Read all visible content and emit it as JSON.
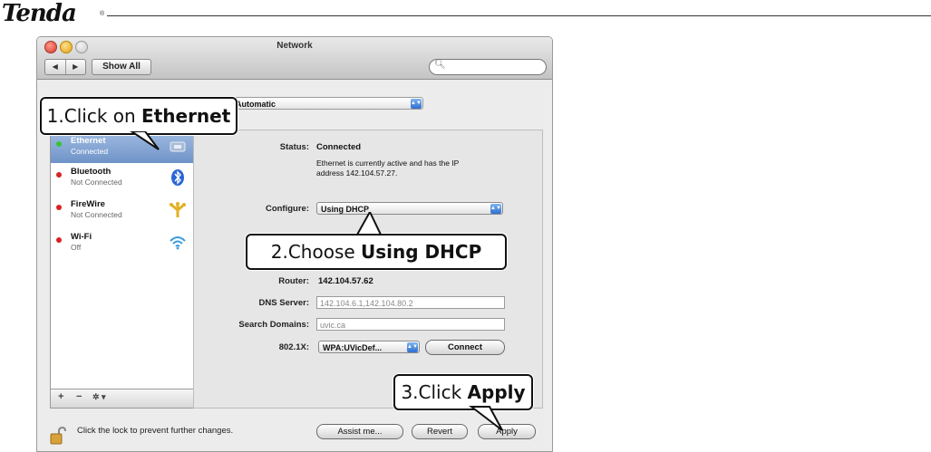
{
  "brand": {
    "name": "Tenda",
    "tm": "®"
  },
  "window": {
    "title": "Network",
    "nav_back": "◀",
    "nav_forward": "▶",
    "show_all": "Show All",
    "search_placeholder": ""
  },
  "location": {
    "value": "Automatic"
  },
  "services": [
    {
      "name": "Ethernet",
      "status": "Connected",
      "dot": "#35c435",
      "icon": "ethernet-icon"
    },
    {
      "name": "Bluetooth",
      "status": "Not Connected",
      "dot": "#d92121",
      "icon": "bluetooth-icon"
    },
    {
      "name": "FireWire",
      "status": "Not Connected",
      "dot": "#d92121",
      "icon": "firewire-icon"
    },
    {
      "name": "Wi-Fi",
      "status": "Off",
      "dot": "#d92121",
      "icon": "wifi-icon"
    }
  ],
  "sidebar_actions": {
    "add": "+",
    "remove": "−",
    "gear": "✲ ▾"
  },
  "detail": {
    "status_label": "Status:",
    "status_value": "Connected",
    "status_desc_1": "Ethernet is currently active and has the IP",
    "status_desc_2": "address 142.104.57.27.",
    "configure_label": "Configure:",
    "configure_value": "Using DHCP",
    "router_label": "Router:",
    "router_value": "142.104.57.62",
    "dns_label": "DNS Server:",
    "dns_value": "142.104.6.1,142.104.80.2",
    "search_domains_label": "Search Domains:",
    "search_domains_value": "uvic.ca",
    "dot1x_label": "802.1X:",
    "dot1x_value": "WPA:UVicDef...",
    "connect_button": "Connect"
  },
  "footer": {
    "lock_text": "Click the lock to prevent further changes.",
    "assist_button": "Assist me...",
    "revert_button": "Revert",
    "apply_button": "Apply"
  },
  "callouts": {
    "step1_prefix": "1.Click on ",
    "step1_bold": "Ethernet",
    "step2_prefix": "2.Choose ",
    "step2_bold": "Using DHCP",
    "step3_prefix": "3.Click ",
    "step3_bold": "Apply"
  },
  "colors": {
    "selection": "#7d9fd2",
    "connected": "#35c435",
    "disconnected": "#d92121",
    "accent": "#2f6fd0"
  }
}
